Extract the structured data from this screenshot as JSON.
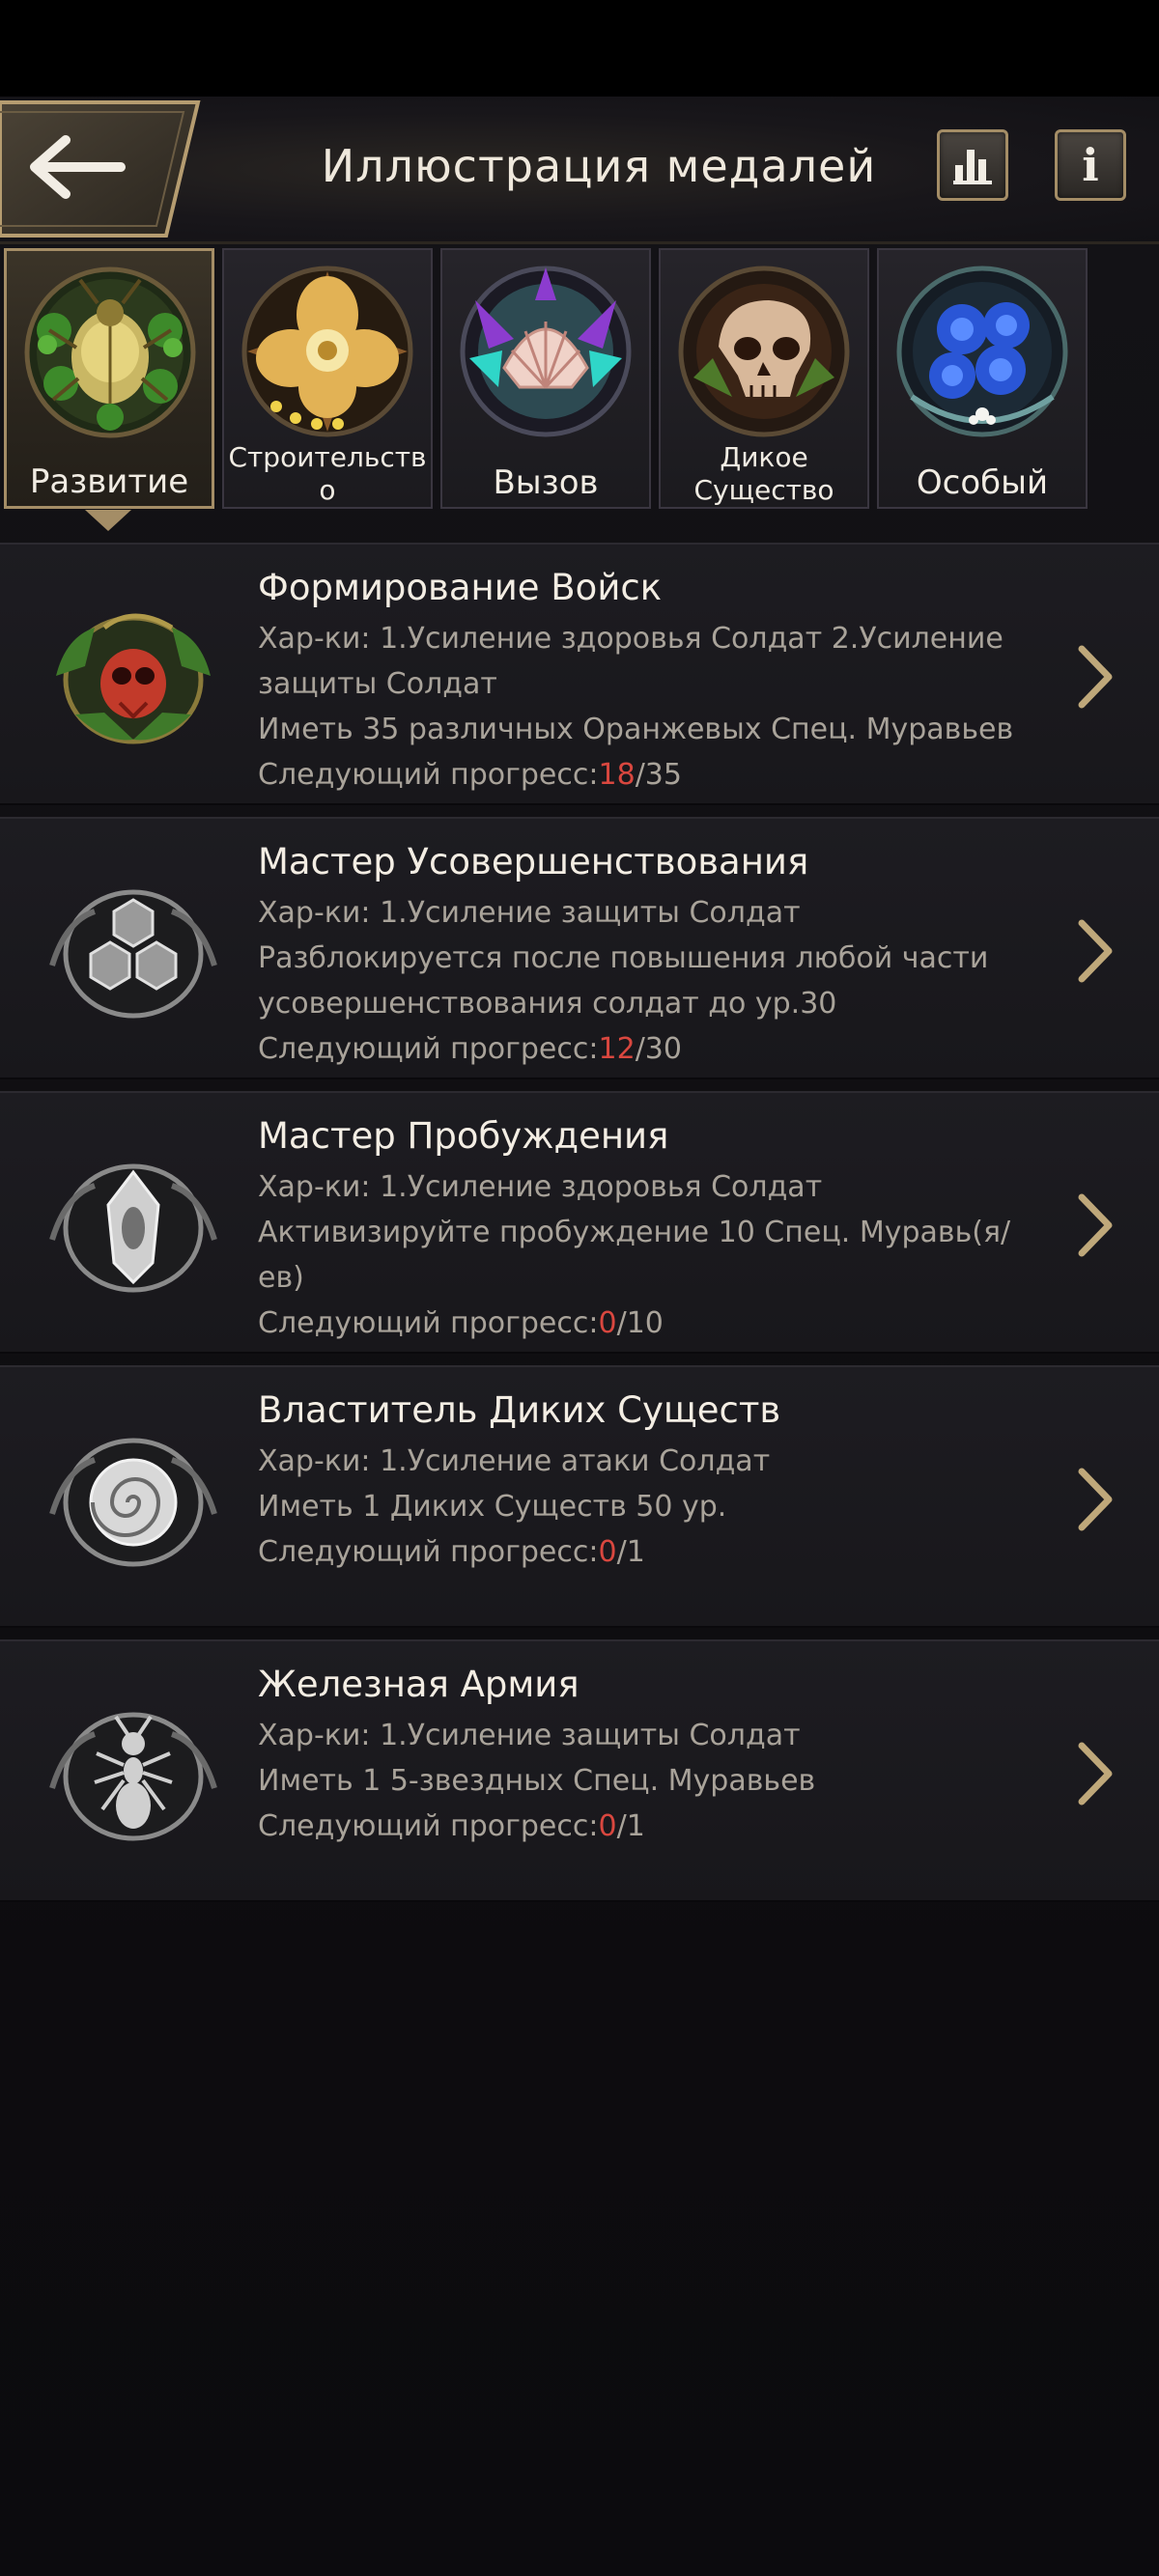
{
  "header": {
    "title": "Иллюстрация медалей",
    "info_label": "i"
  },
  "tabs": [
    {
      "label": "Развитие",
      "icon": "beetle-medal-icon",
      "active": true
    },
    {
      "label": "Строительств\nо",
      "icon": "flower-medal-icon",
      "active": false
    },
    {
      "label": "Вызов",
      "icon": "shell-medal-icon",
      "active": false
    },
    {
      "label": "Дикое\nСущество",
      "icon": "skull-medal-icon",
      "active": false
    },
    {
      "label": "Особый",
      "icon": "blue-flowers-medal-icon",
      "active": false
    }
  ],
  "medals": [
    {
      "title": "Формирование Войск",
      "lines": [
        "Хар-ки: 1.Усиление здоровья Солдат 2.Усиление",
        "защиты Солдат",
        "Иметь 35 различных Оранжевых Спец. Муравьев"
      ],
      "progress_label": "Следующий прогресс:",
      "progress_current": "18",
      "progress_total": "/35",
      "icon": "red-ant-medal-icon"
    },
    {
      "title": "Мастер Усовершенствования",
      "lines": [
        "Хар-ки: 1.Усиление защиты Солдат",
        "Разблокируется после повышения любой части",
        "усовершенствования солдат до ур.30"
      ],
      "progress_label": "Следующий прогресс:",
      "progress_current": "12",
      "progress_total": "/30",
      "icon": "hexagon-medal-icon"
    },
    {
      "title": "Мастер Пробуждения",
      "lines": [
        "Хар-ки: 1.Усиление здоровья Солдат",
        "Активизируйте пробуждение 10 Спец. Муравь(я/ев)"
      ],
      "progress_label": "Следующий прогресс:",
      "progress_current": "0",
      "progress_total": "/10",
      "icon": "crystal-medal-icon"
    },
    {
      "title": "Властитель Диких Существ",
      "lines": [
        "Хар-ки: 1.Усиление атаки Солдат",
        "Иметь 1 Диких Существ 50 ур."
      ],
      "progress_label": "Следующий прогресс:",
      "progress_current": "0",
      "progress_total": "/1",
      "icon": "snail-shell-medal-icon"
    },
    {
      "title": "Железная Армия",
      "lines": [
        "Хар-ки: 1.Усиление защиты Солдат",
        "Иметь 1 5-звездных Спец. Муравьев"
      ],
      "progress_label": "Следующий прогресс:",
      "progress_current": "0",
      "progress_total": "/1",
      "icon": "ant-medal-icon"
    }
  ],
  "colors": {
    "gold": "#a48d66",
    "progress_current": "#d9473f",
    "text_primary": "#f3ede3",
    "text_secondary": "#a9a39a"
  }
}
